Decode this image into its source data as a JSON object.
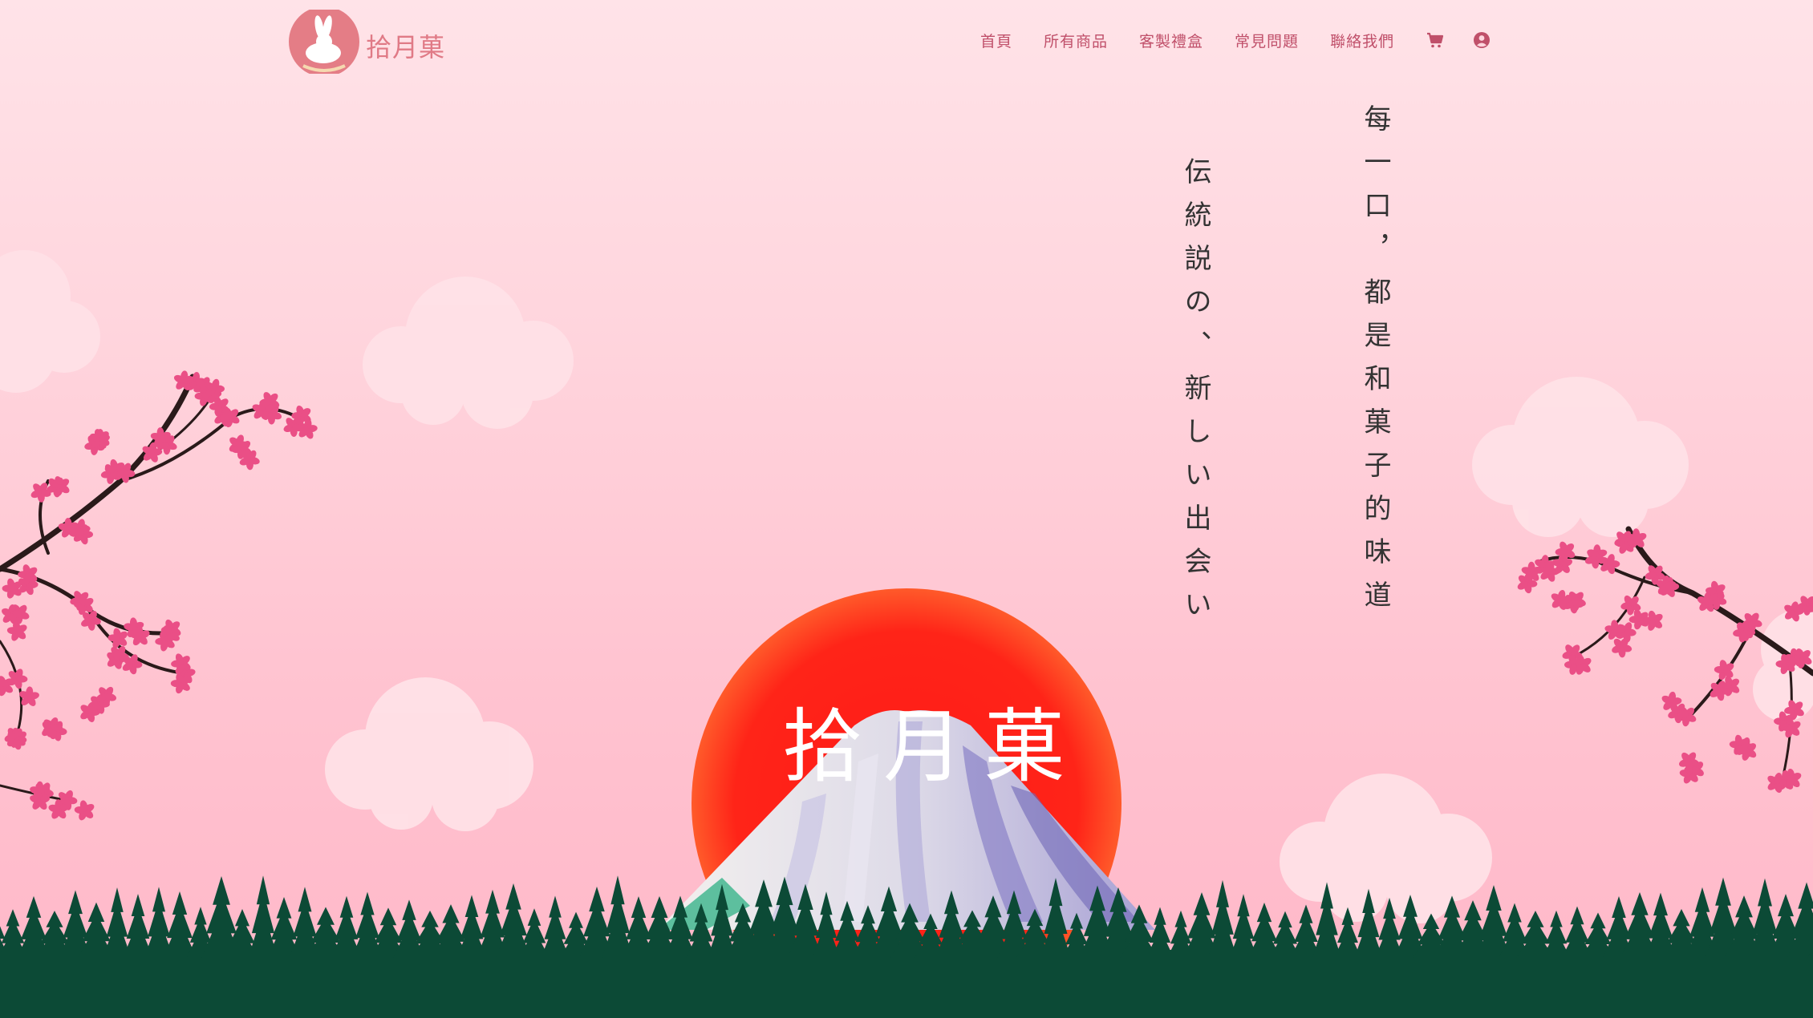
{
  "brand": {
    "name": "拾月菓"
  },
  "nav": {
    "items": [
      {
        "label": "首頁"
      },
      {
        "label": "所有商品"
      },
      {
        "label": "客製禮盒"
      },
      {
        "label": "常見問題"
      },
      {
        "label": "聯絡我們"
      }
    ],
    "cart_icon": "cart-icon",
    "account_icon": "user-circle-icon"
  },
  "hero": {
    "tagline_right": "每一口，都是和菓子的味道",
    "tagline_left": "伝統説の、新しい出会い",
    "sun_text": "拾月菓"
  },
  "colors": {
    "accent": "#c0506a",
    "sun": "#ff2a1c",
    "forest": "#0c4a36",
    "blossom": "#ea4f86",
    "sky_top": "#ffe3e8",
    "sky_bottom": "#ffb7c8"
  }
}
